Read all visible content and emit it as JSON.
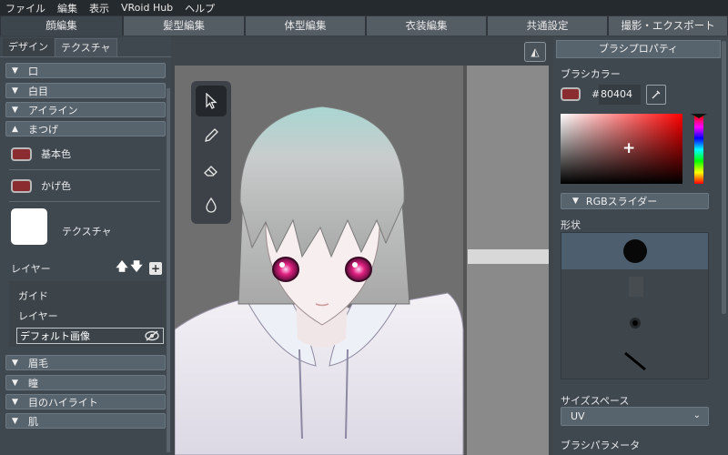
{
  "menubar": {
    "items": [
      "ファイル",
      "編集",
      "表示",
      "VRoid Hub",
      "ヘルプ"
    ]
  },
  "main_tabs": [
    "顔編集",
    "髪型編集",
    "体型編集",
    "衣装編集",
    "共通設定",
    "撮影・エクスポート"
  ],
  "left_panel": {
    "subtabs": [
      "デザイン",
      "テクスチャ"
    ],
    "sections_top": [
      "口",
      "白目",
      "アイライン"
    ],
    "expanded_section": "まつげ",
    "base_color_label": "基本色",
    "shade_color_label": "かげ色",
    "texture_label": "テクスチャ",
    "layer_label": "レイヤー",
    "layers": [
      "ガイド",
      "レイヤー",
      "デフォルト画像"
    ],
    "sections_bottom": [
      "眉毛",
      "瞳",
      "目のハイライト",
      "肌"
    ]
  },
  "right_panel": {
    "header": "ブラシプロパティ",
    "brush_color_label": "ブラシカラー",
    "hex_value": "80404",
    "hash": "#",
    "rgb_slider_label": "RGBスライダー",
    "shape_label": "形状",
    "size_space_label": "サイズスペース",
    "size_space_value": "UV",
    "brush_param_label": "ブラシパラメータ"
  },
  "colors": {
    "accent": "#4d5f6f",
    "swatch": "#8b2c31"
  }
}
